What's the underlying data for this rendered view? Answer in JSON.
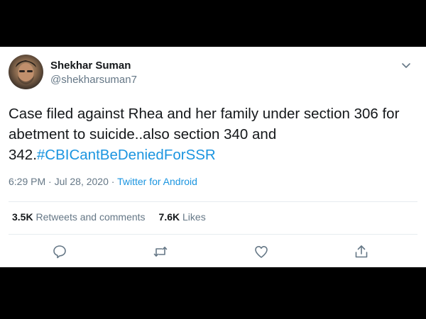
{
  "author": {
    "name": "Shekhar Suman",
    "handle": "@shekharsuman7"
  },
  "tweet": {
    "text": "Case filed against Rhea and her family under section 306 for abetment to suicide..also section 340 and 342.",
    "hashtag": "#CBICantBeDeniedForSSR"
  },
  "meta": {
    "time": "6:29 PM",
    "separator_1": " · ",
    "date": "Jul 28, 2020",
    "separator_2": " · ",
    "source": "Twitter for Android"
  },
  "stats": {
    "retweets_count": "3.5K",
    "retweets_label": "Retweets and comments",
    "likes_count": "7.6K",
    "likes_label": "Likes"
  },
  "icons": {
    "menu": "chevron-down-icon",
    "reply": "reply-icon",
    "retweet": "retweet-icon",
    "like": "like-icon",
    "share": "share-icon"
  },
  "colors": {
    "link": "#1b95e0",
    "secondary_text": "#657786",
    "primary_text": "#14171a",
    "divider": "#e6ecf0"
  }
}
